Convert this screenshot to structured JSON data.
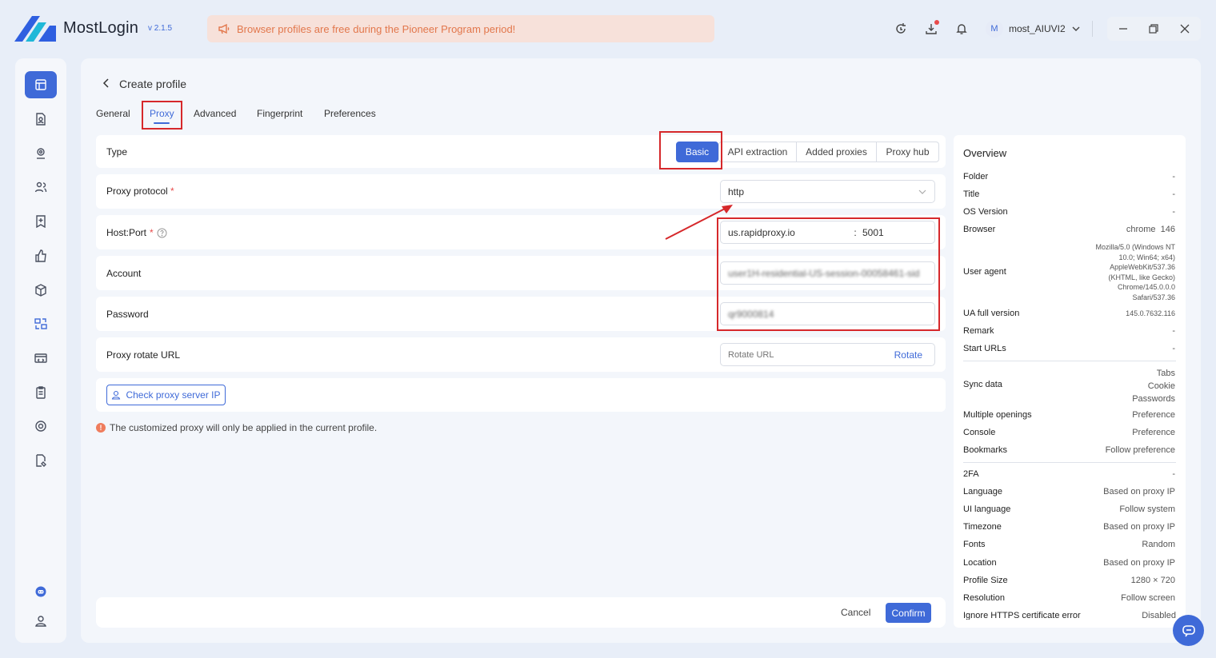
{
  "app": {
    "name": "MostLogin",
    "version": "v 2.1.5"
  },
  "banner": {
    "text": "Browser profiles are free during the Pioneer Program period!"
  },
  "user": {
    "avatar_letter": "M",
    "name": "most_AIUVI2"
  },
  "page": {
    "title": "Create profile"
  },
  "tabs": [
    {
      "label": "General"
    },
    {
      "label": "Proxy",
      "active": true
    },
    {
      "label": "Advanced"
    },
    {
      "label": "Fingerprint"
    },
    {
      "label": "Preferences"
    }
  ],
  "proxy": {
    "type_label": "Type",
    "type_options": [
      "Basic",
      "API extraction",
      "Added proxies",
      "Proxy hub"
    ],
    "type_selected": "Basic",
    "protocol_label": "Proxy protocol",
    "protocol_value": "http",
    "hostport_label": "Host:Port",
    "host_value": "us.rapidproxy.io",
    "port_separator": ":",
    "port_value": "5001",
    "account_label": "Account",
    "account_value": "user1H-residential-US-session-00058461-sid",
    "password_label": "Password",
    "password_value": "qr9000814",
    "rotate_label": "Proxy rotate URL",
    "rotate_placeholder": "Rotate URL",
    "rotate_button": "Rotate",
    "check_button": "Check proxy server IP",
    "notice": "The customized proxy will only be applied in the current profile.",
    "required_mark": "*"
  },
  "footer": {
    "cancel": "Cancel",
    "confirm": "Confirm"
  },
  "overview": {
    "title": "Overview",
    "rows": [
      {
        "key": "Folder",
        "value": "-"
      },
      {
        "key": "Title",
        "value": "-"
      },
      {
        "key": "OS Version",
        "value": "-"
      },
      {
        "key": "Browser",
        "value": "chrome  146"
      },
      {
        "key": "User agent",
        "value": "Mozilla/5.0 (Windows NT 10.0; Win64; x64) AppleWebKit/537.36 (KHTML, like Gecko) Chrome/145.0.0.0 Safari/537.36"
      },
      {
        "key": "UA full version",
        "value": "145.0.7632.116"
      },
      {
        "key": "Remark",
        "value": "-"
      },
      {
        "key": "Start URLs",
        "value": "-"
      },
      {
        "key": "Sync data",
        "value": "Tabs\nCookie\nPasswords"
      },
      {
        "key": "Multiple openings",
        "value": "Preference"
      },
      {
        "key": "Console",
        "value": "Preference"
      },
      {
        "key": "Bookmarks",
        "value": "Follow preference"
      },
      {
        "key": "2FA",
        "value": "-"
      },
      {
        "key": "Language",
        "value": "Based on proxy IP"
      },
      {
        "key": "UI language",
        "value": "Follow system"
      },
      {
        "key": "Timezone",
        "value": "Based on proxy IP"
      },
      {
        "key": "Fonts",
        "value": "Random"
      },
      {
        "key": "Location",
        "value": "Based on proxy IP"
      },
      {
        "key": "Profile Size",
        "value": "1280 × 720"
      },
      {
        "key": "Resolution",
        "value": "Follow screen"
      },
      {
        "key": "Ignore HTTPS certificate error",
        "value": "Disabled"
      }
    ]
  },
  "colors": {
    "accent": "#3f6ad8",
    "annotation_red": "#d6282b",
    "banner_text": "#e2774c"
  },
  "icons": {
    "sidebar": [
      "profiles-icon",
      "file-user-icon",
      "proxy-location-icon",
      "team-icon",
      "bookmark-add-icon",
      "thumbs-up-icon",
      "cube-icon",
      "sync-icon",
      "api-icon",
      "clipboard-icon",
      "extension-icon",
      "file-edit-icon",
      "discord-icon",
      "user-icon"
    ]
  }
}
